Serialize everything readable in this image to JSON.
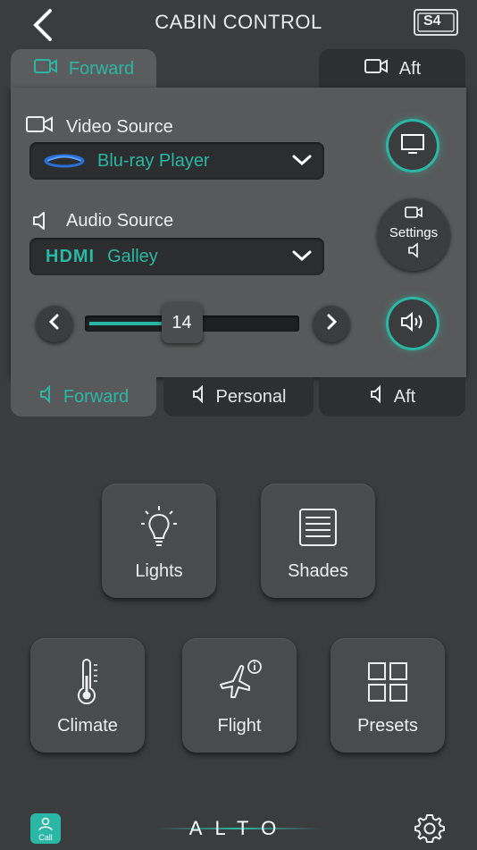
{
  "header": {
    "title": "CABIN CONTROL",
    "badge": "S4"
  },
  "top_tabs": {
    "forward": "Forward",
    "aft": "Aft"
  },
  "video": {
    "label": "Video Source",
    "value": "Blu-ray Player"
  },
  "audio": {
    "label": "Audio Source",
    "value": "Galley",
    "brand": "HDMI"
  },
  "settings_label": "Settings",
  "volume": {
    "value": "14",
    "level": 0.45
  },
  "bottom_tabs": {
    "forward": "Forward",
    "personal": "Personal",
    "aft": "Aft"
  },
  "tiles": {
    "lights": "Lights",
    "shades": "Shades",
    "climate": "Climate",
    "flight": "Flight",
    "presets": "Presets"
  },
  "footer": {
    "call": "Call",
    "logo": "ALTO"
  },
  "colors": {
    "accent": "#2bb7a5",
    "background": "#3a3c3d",
    "panel": "#58595a"
  },
  "icons": [
    "back-arrow-icon",
    "s4-badge-icon",
    "video-camera-icon",
    "speaker-icon",
    "bluray-icon",
    "hdmi-icon",
    "display-icon",
    "settings-icon",
    "chevron-left-icon",
    "chevron-right-icon",
    "volume-icon",
    "lightbulb-icon",
    "shades-icon",
    "thermometer-icon",
    "flight-info-icon",
    "presets-grid-icon",
    "call-icon",
    "gear-icon"
  ]
}
